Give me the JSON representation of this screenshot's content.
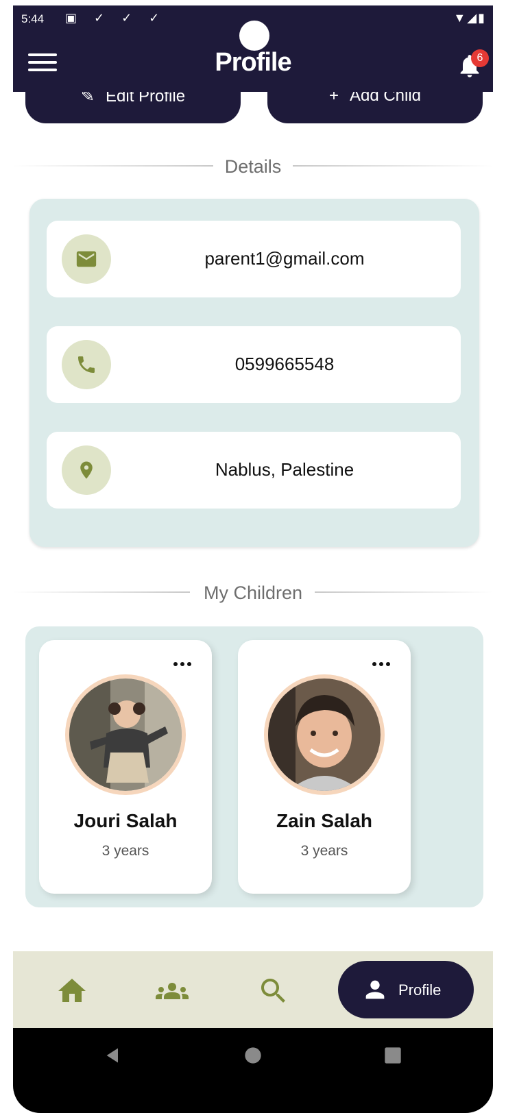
{
  "status_bar": {
    "time": "5:44"
  },
  "app_bar": {
    "title": "Profile",
    "notification_count": "6"
  },
  "actions": {
    "edit_label": "Edit Profile",
    "add_label": "Add Child"
  },
  "details": {
    "section_label": "Details",
    "email": "parent1@gmail.com",
    "phone": "0599665548",
    "location": "Nablus, Palestine"
  },
  "children": {
    "section_label": "My Children",
    "items": [
      {
        "name": "Jouri Salah",
        "age": "3 years"
      },
      {
        "name": "Zain Salah",
        "age": "3 years"
      }
    ]
  },
  "bottom_nav": {
    "profile_label": "Profile"
  },
  "colors": {
    "primary_dark": "#1e1a3a",
    "card_bg": "#dcebea",
    "icon_circle": "#dfe4c8",
    "icon_olive": "#7d8c3a",
    "nav_bg": "#e6e6d5",
    "badge_red": "#e53935"
  },
  "icons": [
    "menu-icon",
    "bell-icon",
    "edit-icon",
    "plus-icon",
    "mail-icon",
    "phone-icon",
    "location-icon",
    "more-icon",
    "home-icon",
    "group-icon",
    "search-icon",
    "person-icon",
    "back-icon",
    "home-circle-icon",
    "recents-icon"
  ]
}
